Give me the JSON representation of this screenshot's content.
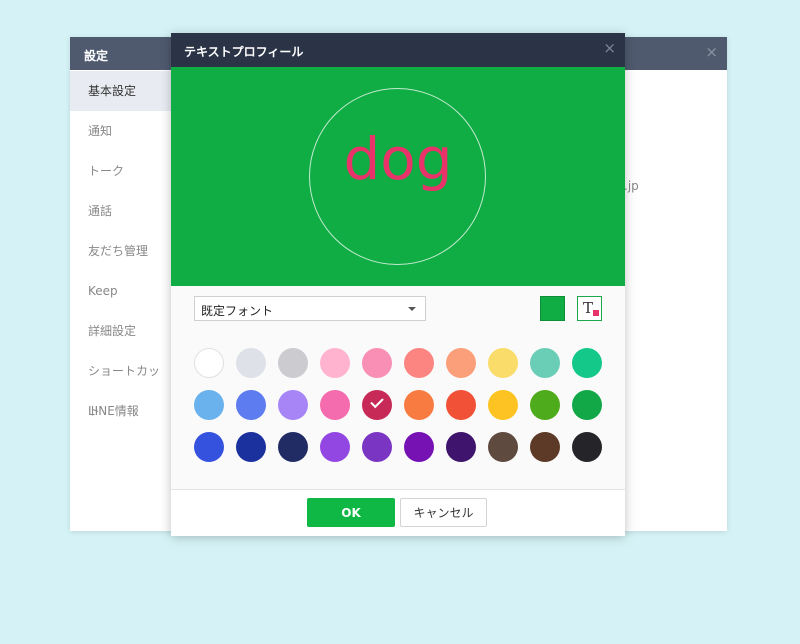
{
  "settings_window": {
    "title": "設定",
    "close_glyph": "×",
    "sidebar": [
      {
        "label": "基本設定",
        "active": true
      },
      {
        "label": "通知",
        "active": false
      },
      {
        "label": "トーク",
        "active": false
      },
      {
        "label": "通話",
        "active": false
      },
      {
        "label": "友だち管理",
        "active": false
      },
      {
        "label": "Keep",
        "active": false
      },
      {
        "label": "詳細設定",
        "active": false
      },
      {
        "label": "ショートカット",
        "active": false
      },
      {
        "label": "LINE情報",
        "active": false
      }
    ],
    "content_fragment": ".jp"
  },
  "dialog": {
    "title": "テキストプロフィール",
    "close_glyph": "×",
    "preview": {
      "text": "dog",
      "background_color": "#0fad43",
      "text_color": "#e8336a"
    },
    "font_select": {
      "value": "既定フォント"
    },
    "background_color_button": {
      "color": "#0fad43"
    },
    "text_color_button": {
      "glyph": "T",
      "color": "#e8336a"
    },
    "palette": [
      [
        "#ffffff",
        "#dfe1e8",
        "#cbcbd0",
        "#ffb3cf",
        "#f98fb5",
        "#fc8582",
        "#fb9e7a",
        "#fadc6a",
        "#6acdb5",
        "#13c889"
      ],
      [
        "#6ab2ee",
        "#5c7cef",
        "#a785f6",
        "#f56cae",
        "#c72a56",
        "#f87c42",
        "#f15237",
        "#fcc322",
        "#4eab1b",
        "#12a848"
      ],
      [
        "#3552df",
        "#1b319e",
        "#222c64",
        "#9246e2",
        "#7a35c3",
        "#7612b4",
        "#3f146d",
        "#5e4a3e",
        "#5d3a27",
        "#242429"
      ]
    ],
    "selected_swatch": {
      "row": 1,
      "col": 4
    },
    "ok_label": "OK",
    "cancel_label": "キャンセル"
  },
  "colors": {
    "desktop_background": "#d5f3f6",
    "settings_titlebar": "#4f5a6f",
    "dialog_titlebar": "#2a3446",
    "accent_green": "#0fb844"
  }
}
